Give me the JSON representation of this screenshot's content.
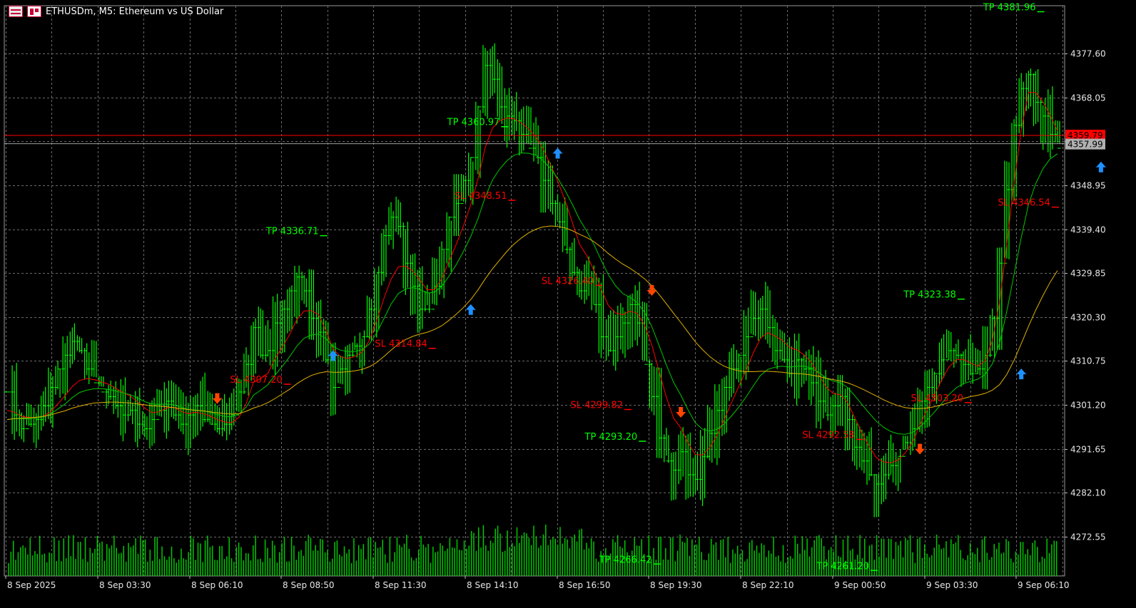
{
  "header": {
    "title": "ETHUSDm, M5:  Ethereum vs US Dollar",
    "icon_left": "table-grid-icon",
    "icon_right": "chart-template-icon"
  },
  "colors": {
    "background": "#000000",
    "grid": "#6b6b6b",
    "candle": "#00ff00",
    "ma_fast": "#ff0000",
    "ma_mid": "#00c800",
    "ma_slow": "#e0b000",
    "bid_line": "#ff0000",
    "ask_line": "#a0a0a0",
    "buy_arrow": "#1e90ff",
    "sell_arrow": "#ff4500",
    "tp_text": "#00ff00",
    "sl_text": "#ff0000",
    "volume": "#00c800"
  },
  "chart_data": {
    "type": "candlestick",
    "symbol": "ETHUSDm",
    "timeframe": "M5",
    "ylim": [
      4264.0,
      4388.0
    ],
    "y_ticks": [
      "4377.60",
      "4368.05",
      "4358.50",
      "4348.95",
      "4339.40",
      "4329.85",
      "4320.30",
      "4310.75",
      "4301.20",
      "4291.65",
      "4282.10",
      "4272.55"
    ],
    "x_ticks": [
      "8 Sep 2025",
      "8 Sep 03:30",
      "8 Sep 06:10",
      "8 Sep 08:50",
      "8 Sep 11:30",
      "8 Sep 14:10",
      "8 Sep 16:50",
      "8 Sep 19:30",
      "8 Sep 22:10",
      "9 Sep 00:50",
      "9 Sep 03:30",
      "9 Sep 06:10"
    ],
    "price_labels": {
      "bid": "4359.79",
      "ask": "4357.99"
    },
    "series": [
      {
        "name": "",
        "values": [
          4304,
          4299,
          4296,
          4297,
          4298,
          4301,
          4305,
          4309,
          4312,
          4315,
          4313,
          4309,
          4306,
          4304,
          4303,
          4301,
          4299,
          4300,
          4297,
          4296,
          4298,
          4300,
          4302,
          4299,
          4297,
          4299,
          4301,
          4298,
          4297,
          4296,
          4297,
          4299,
          4304,
          4310,
          4318,
          4312,
          4313,
          4319,
          4322,
          4326,
          4329,
          4326,
          4320,
          4317,
          4311,
          4305,
          4309,
          4312,
          4314,
          4316,
          4322,
          4330,
          4338,
          4342,
          4340,
          4332,
          4327,
          4322,
          4322,
          4327,
          4335,
          4342,
          4345,
          4350,
          4355,
          4366,
          4375,
          4372,
          4366,
          4364,
          4363,
          4360,
          4357,
          4355,
          4350,
          4345,
          4341,
          4335,
          4330,
          4326,
          4328,
          4323,
          4316,
          4313,
          4316,
          4319,
          4323,
          4319,
          4310,
          4303,
          4294,
          4289,
          4287,
          4291,
          4286,
          4285,
          4290,
          4295,
          4300,
          4305,
          4309,
          4312,
          4316,
          4320,
          4322,
          4318,
          4313,
          4311,
          4308,
          4311,
          4309,
          4306,
          4302,
          4299,
          4301,
          4303,
          4298,
          4292,
          4289,
          4286,
          4284,
          4286,
          4288,
          4290,
          4293,
          4296,
          4302,
          4305,
          4308,
          4311,
          4313,
          4312,
          4310,
          4308,
          4309,
          4312,
          4320,
          4332,
          4348,
          4362,
          4370,
          4373,
          4367,
          4364,
          4360,
          4357
        ]
      },
      {
        "name": "",
        "values": [
          4300,
          4299.6,
          4298.7,
          4298.5,
          4298.3,
          4298.7,
          4299.7,
          4301.4,
          4303.2,
          4305.2,
          4306.5,
          4306.9,
          4306.7,
          4306.2,
          4305.7,
          4304.8,
          4303.9,
          4303.1,
          4301.9,
          4300.5,
          4299.5,
          4299.7,
          4300.5,
          4300.7,
          4299.8,
          4299.3,
          4299.6,
          4299.3,
          4298.8,
          4298,
          4297.5,
          4297.3,
          4298.5,
          4301.5,
          4306.1,
          4306.9,
          4308.1,
          4311.3,
          4313.8,
          4316.5,
          4319.8,
          4321.6,
          4321.7,
          4320.8,
          4317.4,
          4313.4,
          4311.7,
          4311.3,
          4311.7,
          4312.7,
          4315.2,
          4319.5,
          4324.3,
          4328.5,
          4331.2,
          4331.4,
          4330.3,
          4328.3,
          4326.2,
          4326.3,
          4328.6,
          4332.5,
          4336.1,
          4340.2,
          4344.7,
          4350.3,
          4357.2,
          4361.4,
          4363,
          4363.6,
          4363.4,
          4362.5,
          4361.2,
          4359.5,
          4356.8,
          4353.5,
          4349.9,
          4345.7,
          4341,
          4336.2,
          4333.7,
          4330.5,
          4326.3,
          4322.8,
          4321.2,
          4320.8,
          4321.6,
          4321.1,
          4318.5,
          4314.2,
          4308.4,
          4302.9,
          4298.3,
          4296.2,
          4292.9,
          4290.4,
          4290.3,
          4291.9,
          4294.6,
          4298.1,
          4301.7,
          4305.2,
          4308.7,
          4312.5,
          4315.7,
          4316.9,
          4316.2,
          4315.2,
          4313.7,
          4313.2,
          4312.1,
          4310.5,
          4307.9,
          4305.2,
          4303.7,
          4303.4,
          4301.8,
          4298.4,
          4295.1,
          4292.1,
          4289.7,
          4288.8,
          4288.6,
          4289.2,
          4290.8,
          4293.1,
          4296.8,
          4300.2,
          4303.4,
          4306.6,
          4309.4,
          4311,
          4311.1,
          4310.3,
          4309.6,
          4310.8,
          4315.2,
          4323.5,
          4336.1,
          4349.5,
          4361,
          4369.2,
          4369.1,
          4367.1,
          4364.1,
          4360.8
        ]
      },
      {
        "name": "",
        "values": [
          4298,
          4298.2,
          4298.2,
          4298.2,
          4298.3,
          4298.6,
          4299.2,
          4300.3,
          4301.4,
          4302.8,
          4303.9,
          4304.4,
          4304.7,
          4304.7,
          4304.6,
          4304.2,
          4303.8,
          4303.4,
          4302.7,
          4301.9,
          4301.4,
          4301.3,
          4301.4,
          4301.2,
          4300.7,
          4300.2,
          4300.1,
          4299.9,
          4299.6,
          4299.1,
          4298.7,
          4298.6,
          4299.2,
          4300.7,
          4303.3,
          4304.4,
          4305.6,
          4307.7,
          4309.6,
          4311.7,
          4314,
          4315.7,
          4316.4,
          4316.6,
          4315.6,
          4313.9,
          4313.1,
          4312.8,
          4312.8,
          4313.2,
          4314.4,
          4316.8,
          4319.9,
          4323.1,
          4325.4,
          4326.4,
          4326.7,
          4326.3,
          4325.5,
          4325.7,
          4327,
          4329.2,
          4331.7,
          4334.6,
          4337.8,
          4341.7,
          4346.4,
          4350.1,
          4352.5,
          4354.3,
          4355.5,
          4356,
          4355.9,
          4355.5,
          4354.3,
          4352.6,
          4350.5,
          4347.9,
          4344.9,
          4341.6,
          4339,
          4336.1,
          4332.7,
          4329.5,
          4327.1,
          4325.4,
          4324.6,
          4323.4,
          4321.3,
          4318.2,
          4314.1,
          4309.9,
          4306.1,
          4303.3,
          4300.1,
          4297.3,
          4295.9,
          4295.5,
          4295.9,
          4297.1,
          4298.8,
          4300.7,
          4302.9,
          4305.3,
          4307.6,
          4308.9,
          4309.4,
          4309.6,
          4309.4,
          4309.6,
          4309.6,
          4309.2,
          4308.3,
          4307.1,
          4306.4,
          4306,
          4305,
          4303.2,
          4301.3,
          4299.4,
          4297.6,
          4296.3,
          4295.4,
          4294.9,
          4294.8,
          4295.2,
          4296.4,
          4297.9,
          4299.6,
          4301.5,
          4303.4,
          4304.9,
          4305.8,
          4306.3,
          4306.8,
          4307.8,
          4310.1,
          4314.6,
          4321.5,
          4329.6,
          4337.6,
          4344.8,
          4349.3,
          4352.6,
          4354.7,
          4355.8
        ]
      },
      {
        "name": "",
        "values": [
          4298,
          4298.2,
          4298.3,
          4298.4,
          4298.5,
          4298.7,
          4299,
          4299.5,
          4299.9,
          4300.5,
          4300.9,
          4301.3,
          4301.6,
          4301.7,
          4301.8,
          4301.8,
          4301.7,
          4301.6,
          4301.4,
          4301.2,
          4301,
          4300.9,
          4300.8,
          4300.6,
          4300.4,
          4300.2,
          4300,
          4299.9,
          4299.7,
          4299.5,
          4299.3,
          4299.2,
          4299.3,
          4299.8,
          4300.5,
          4301,
          4301.7,
          4302.6,
          4303.6,
          4304.6,
          4305.8,
          4306.8,
          4307.6,
          4308.1,
          4308.4,
          4308.3,
          4308.3,
          4308.4,
          4308.6,
          4308.9,
          4309.5,
          4310.4,
          4311.7,
          4313.1,
          4314.4,
          4315.4,
          4316.1,
          4316.6,
          4317,
          4317.6,
          4318.4,
          4319.6,
          4320.9,
          4322.4,
          4324.1,
          4326.2,
          4328.6,
          4330.8,
          4332.7,
          4334.6,
          4336.2,
          4337.5,
          4338.6,
          4339.4,
          4339.9,
          4340.1,
          4340,
          4339.7,
          4339.1,
          4338.3,
          4337.6,
          4336.7,
          4335.5,
          4334.1,
          4332.9,
          4331.8,
          4330.9,
          4329.8,
          4328.6,
          4327.1,
          4325.2,
          4323.2,
          4321.1,
          4319.1,
          4317,
          4314.9,
          4313.2,
          4311.7,
          4310.5,
          4309.6,
          4309,
          4308.6,
          4308.4,
          4308.4,
          4308.5,
          4308.5,
          4308.4,
          4308.3,
          4308.1,
          4308,
          4307.9,
          4307.7,
          4307.4,
          4307,
          4306.7,
          4306.4,
          4306,
          4305.4,
          4304.7,
          4303.9,
          4303.1,
          4302.3,
          4301.6,
          4301,
          4300.6,
          4300.4,
          4300.4,
          4300.5,
          4300.8,
          4301.2,
          4301.7,
          4302.2,
          4302.6,
          4303,
          4303.3,
          4303.7,
          4304.4,
          4305.6,
          4307.8,
          4310.9,
          4314.5,
          4318.3,
          4321.8,
          4325,
          4327.9,
          4330.4
        ]
      }
    ],
    "annotations": [
      {
        "kind": "TP",
        "text": "TP 4381.96",
        "x": 142,
        "y": 4387.0
      },
      {
        "kind": "TP",
        "text": "TP 4360.97",
        "x": 68,
        "y": 4362.0
      },
      {
        "kind": "TP",
        "text": "TP 4336.71",
        "x": 43,
        "y": 4338.3
      },
      {
        "kind": "TP",
        "text": "TP 4323.38",
        "x": 131,
        "y": 4324.5
      },
      {
        "kind": "TP",
        "text": "TP 4293.20",
        "x": 87,
        "y": 4293.6
      },
      {
        "kind": "TP",
        "text": "TP 4266.42",
        "x": 89,
        "y": 4266.9
      },
      {
        "kind": "TP",
        "text": "TP 4261.20",
        "x": 119,
        "y": 4265.5
      },
      {
        "kind": "SL",
        "text": "SL 4348.51",
        "x": 69,
        "y": 4346.0
      },
      {
        "kind": "SL",
        "text": "SL 4346.54",
        "x": 144,
        "y": 4344.5
      },
      {
        "kind": "SL",
        "text": "SL 4326.40",
        "x": 81,
        "y": 4327.5
      },
      {
        "kind": "SL",
        "text": "SL 4314.84",
        "x": 58,
        "y": 4313.8
      },
      {
        "kind": "SL",
        "text": "SL 4307.20",
        "x": 38,
        "y": 4306.0
      },
      {
        "kind": "SL",
        "text": "SL 4303.20",
        "x": 132,
        "y": 4302.0
      },
      {
        "kind": "SL",
        "text": "SL 4299.82",
        "x": 85,
        "y": 4300.5
      },
      {
        "kind": "SL",
        "text": "SL 4292.58",
        "x": 117,
        "y": 4294.0
      }
    ],
    "buy_arrows": [
      {
        "x": 45,
        "y": 4312.0
      },
      {
        "x": 64,
        "y": 4322.0
      },
      {
        "x": 76,
        "y": 4356.0
      },
      {
        "x": 140,
        "y": 4308.0
      },
      {
        "x": 151,
        "y": 4353.0
      }
    ],
    "sell_arrows": [
      {
        "x": 29,
        "y": 4302.5
      },
      {
        "x": 89,
        "y": 4326.0
      },
      {
        "x": 93,
        "y": 4299.5
      },
      {
        "x": 126,
        "y": 4291.5
      }
    ]
  }
}
